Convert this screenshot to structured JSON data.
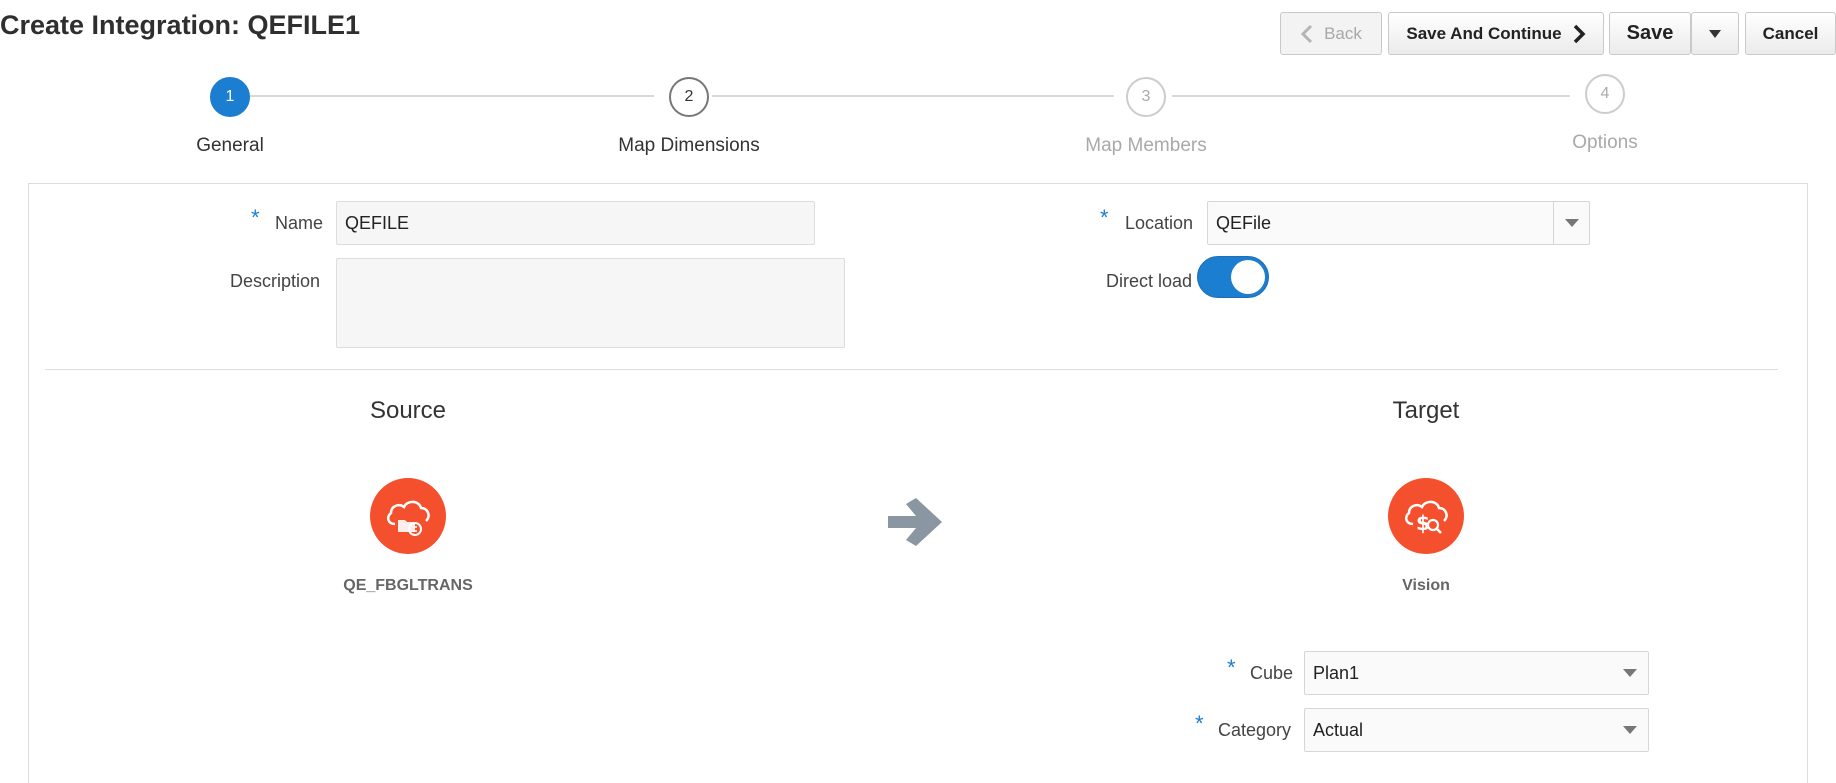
{
  "header": {
    "title": "Create Integration: QEFILE1",
    "back_label": "Back",
    "save_continue_label": "Save And Continue",
    "save_label": "Save",
    "cancel_label": "Cancel"
  },
  "train": {
    "steps": [
      {
        "number": "1",
        "label": "General",
        "state": "active"
      },
      {
        "number": "2",
        "label": "Map Dimensions",
        "state": "enabled"
      },
      {
        "number": "3",
        "label": "Map Members",
        "state": "disabled"
      },
      {
        "number": "4",
        "label": "Options",
        "state": "disabled"
      }
    ]
  },
  "form": {
    "required_mark": "*",
    "name_label": "Name",
    "name_value": "QEFILE",
    "description_label": "Description",
    "description_value": "",
    "location_label": "Location",
    "location_value": "QEFile",
    "direct_load_label": "Direct load",
    "direct_load_on": true
  },
  "source": {
    "title": "Source",
    "app_name": "QE_FBGLTRANS",
    "icon": "cloud-folder-icon"
  },
  "target": {
    "title": "Target",
    "app_name": "Vision",
    "icon": "cloud-dollar-icon",
    "cube_label": "Cube",
    "cube_value": "Plan1",
    "category_label": "Category",
    "category_value": "Actual"
  },
  "colors": {
    "accent": "#1c7ed0",
    "app_icon": "#f5502d",
    "arrow": "#8a96a1"
  }
}
